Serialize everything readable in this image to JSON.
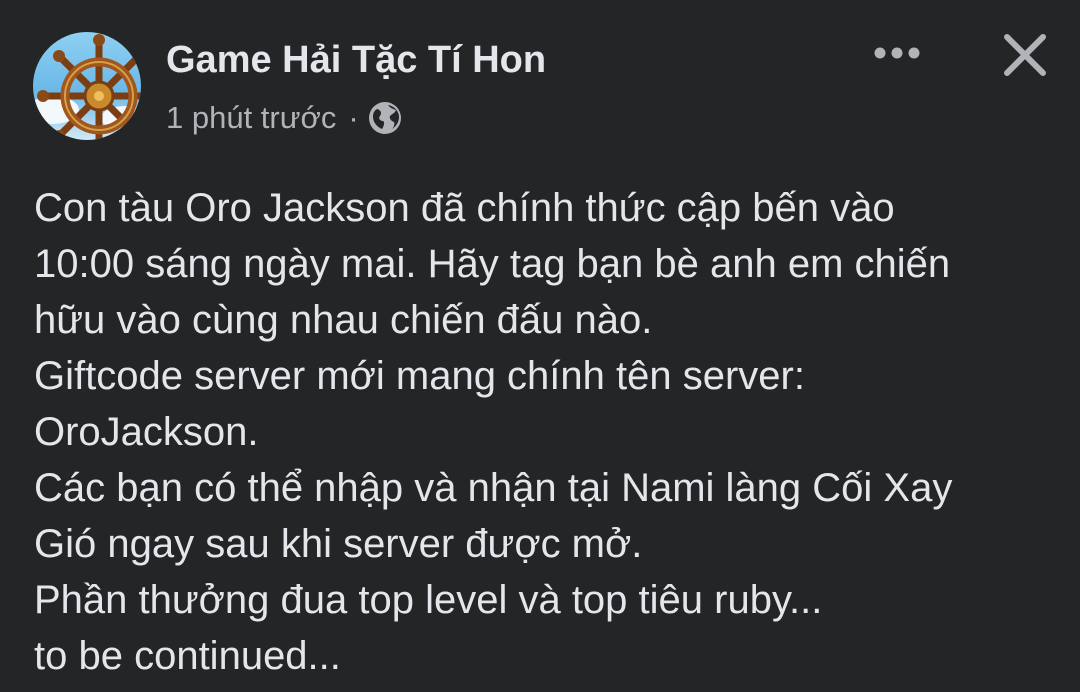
{
  "post": {
    "page_name": "Game Hải Tặc Tí Hon",
    "timestamp": "1 phút trước",
    "separator": "·",
    "privacy_icon": "globe-icon",
    "more_icon": "more-horizontal-icon",
    "close_icon": "close-icon",
    "avatar_icon": "ship-wheel-logo",
    "body_lines": [
      "Con tàu Oro Jackson đã chính thức cập bến vào",
      "10:00 sáng ngày mai. Hãy tag bạn bè anh em chiến",
      "hữu vào cùng nhau chiến đấu nào.",
      "Giftcode server mới mang chính tên server:",
      "OroJackson.",
      "Các bạn có thể nhập và nhận tại Nami làng Cối Xay",
      "Gió ngay sau khi server được mở.",
      "Phần thưởng đua top level và top tiêu ruby...",
      "to be continued..."
    ]
  },
  "colors": {
    "background": "#242526",
    "primary_text": "#e4e6eb",
    "secondary_text": "#b0b3b8"
  }
}
